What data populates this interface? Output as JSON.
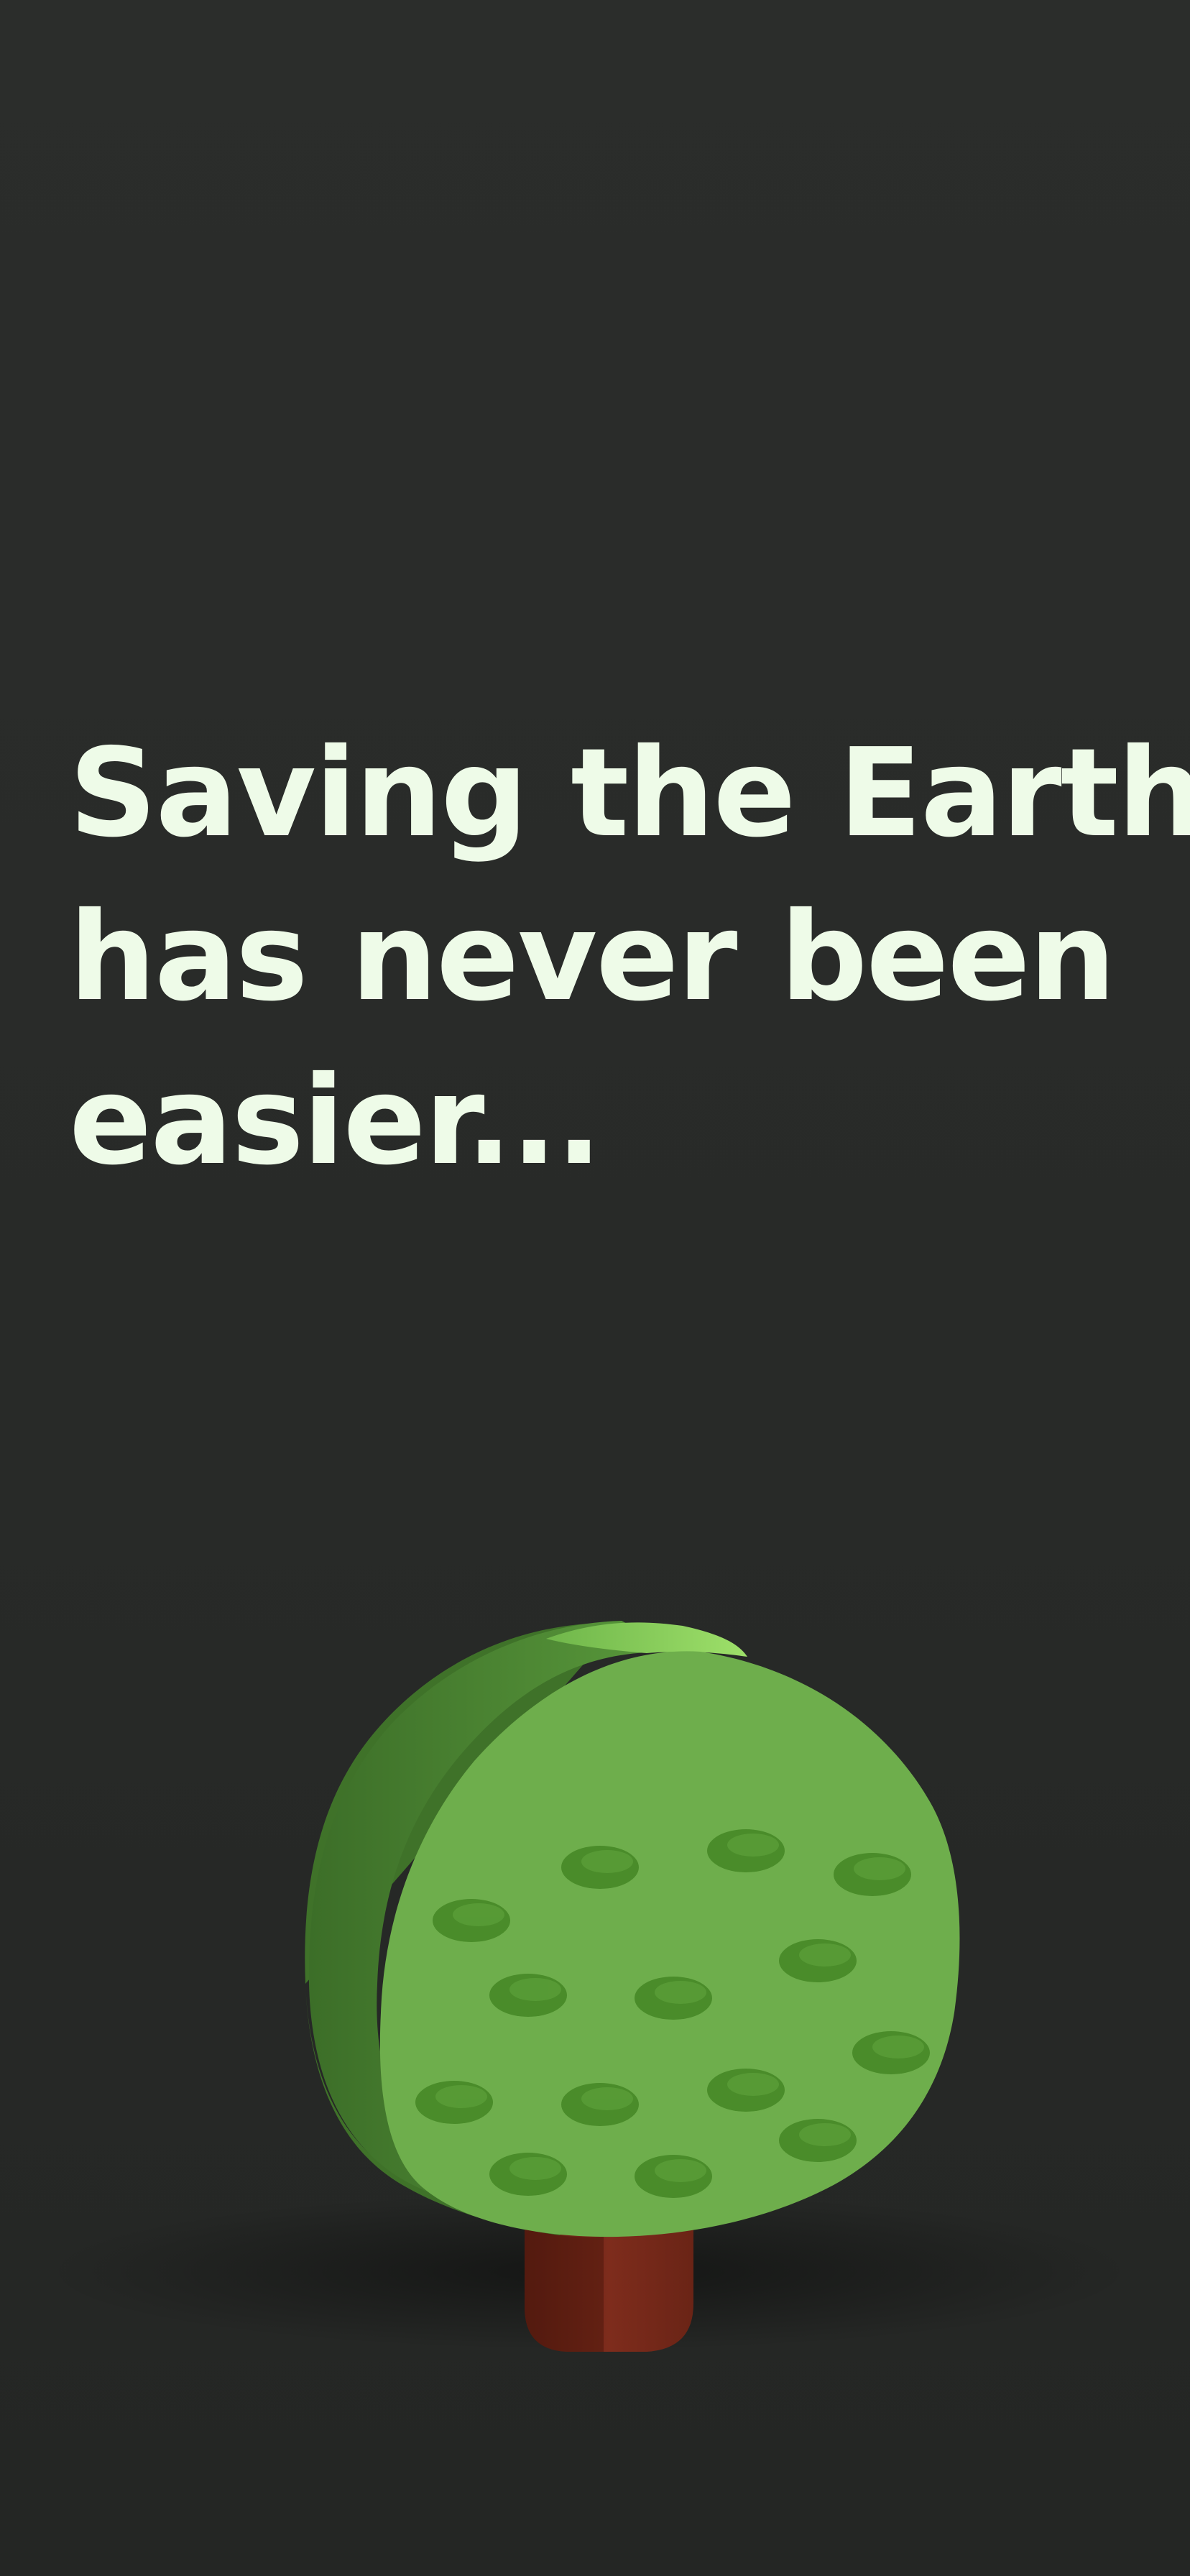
{
  "onboarding": {
    "headline_lines": [
      "Saving the Earth",
      "has never been",
      "easier..."
    ],
    "illustration": "tree-icon",
    "colors": {
      "background": "#282a28",
      "headline_text": "#eefbe8",
      "canopy_front": "#6eae4c",
      "canopy_side": "#4a8232",
      "leaf_spot": "#4c8f2c",
      "trunk": "#7a2a1c"
    }
  }
}
